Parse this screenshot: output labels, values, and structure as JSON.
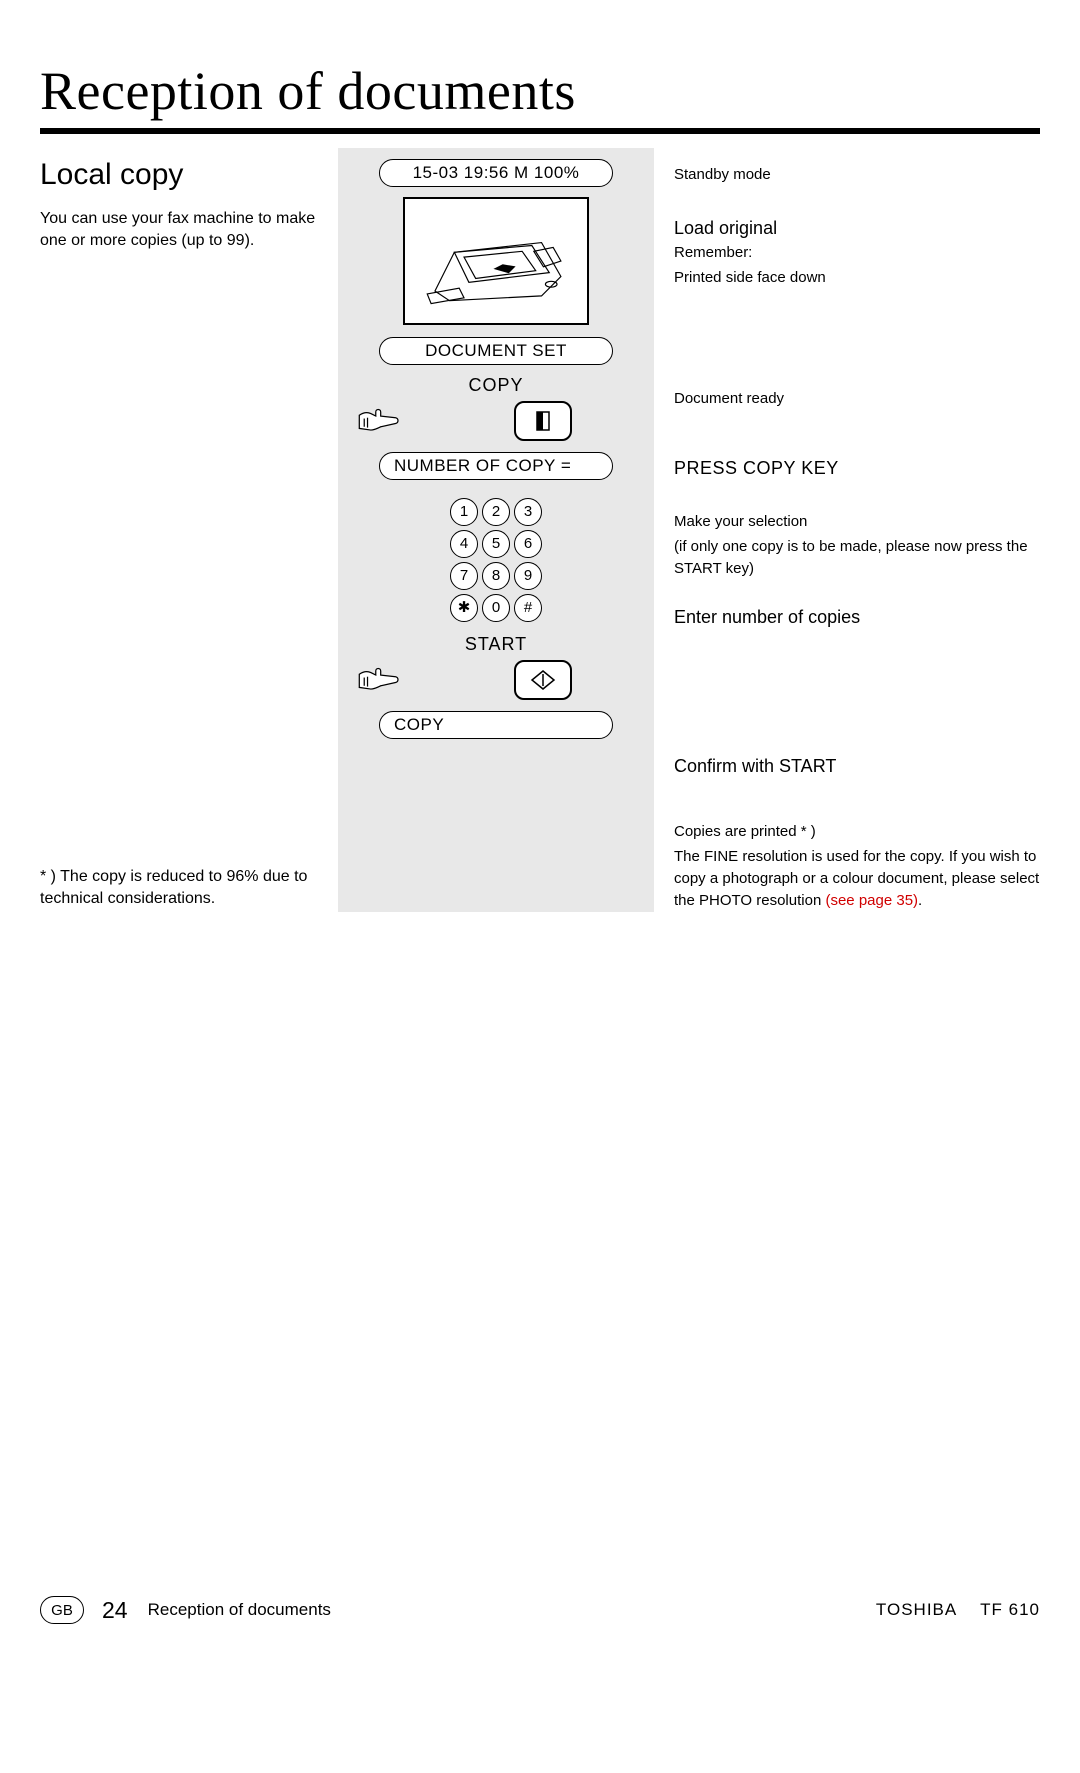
{
  "title": "Reception of documents",
  "subtitle": "Local copy",
  "intro": "You can use your fax machine to make one or more copies (up to 99).",
  "footnote": "* ) The copy is reduced to 96% due to technical considerations.",
  "panel": {
    "lcd1": "15-03 19:56  M 100%",
    "lcd2": "DOCUMENT SET",
    "label_copy": "COPY",
    "lcd3": "NUMBER OF COPY   =",
    "label_start": "START",
    "lcd4": "COPY",
    "keypad": [
      "1",
      "2",
      "3",
      "4",
      "5",
      "6",
      "7",
      "8",
      "9",
      "✱",
      "0",
      "#"
    ]
  },
  "right": {
    "standby": "Standby mode",
    "load_h": "Load original",
    "load_sub1": "Remember:",
    "load_sub2": "Printed side face down",
    "doc_ready": "Document ready",
    "press_copy": "PRESS COPY KEY",
    "make_sel": "Make your selection",
    "make_sel_sub": "(if only one copy is to be made, please now press the START key)",
    "enter_num": "Enter number of copies",
    "confirm": "Confirm with START",
    "copies_h": "Copies are printed * )",
    "copies_body": "The FINE resolution is used for the copy. If you wish to copy a photograph or a colour document, please select the PHOTO resolution ",
    "copies_link": "(see page 35)",
    "copies_tail": "."
  },
  "footer": {
    "gb": "GB",
    "page": "24",
    "section": "Reception of documents",
    "brand": "TOSHIBA",
    "model": "TF 610"
  }
}
